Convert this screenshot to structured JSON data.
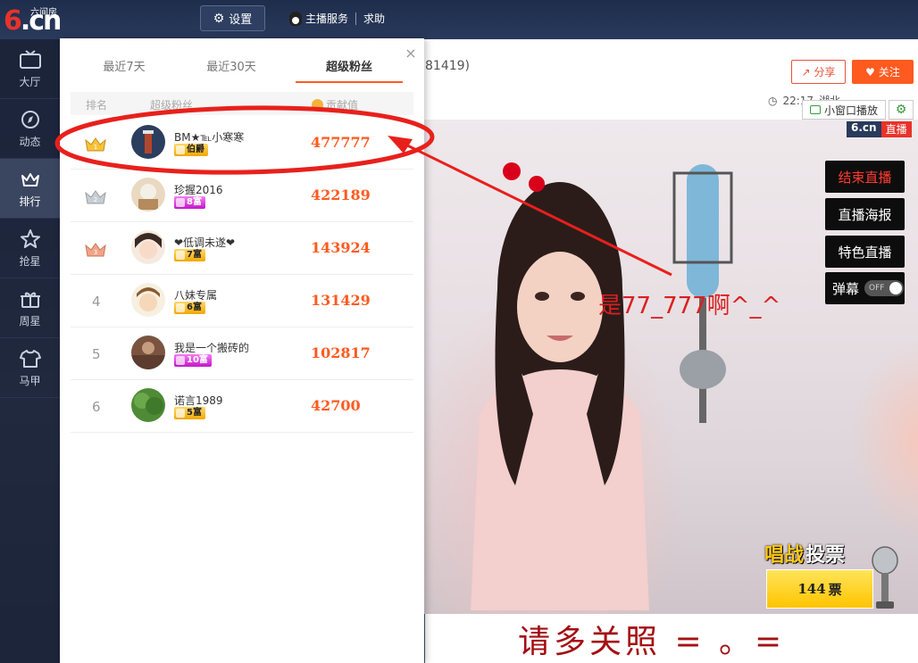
{
  "topbar": {
    "logo_main": "6.cn",
    "logo_sub": "六间房",
    "settings_label": "设置",
    "host_service_label": "主播服务",
    "help_label": "求助"
  },
  "sidebar": {
    "items": [
      {
        "label": "大厅",
        "icon": "tv-icon"
      },
      {
        "label": "动态",
        "icon": "compass-icon"
      },
      {
        "label": "排行",
        "icon": "crown-icon"
      },
      {
        "label": "抢星",
        "icon": "star-icon"
      },
      {
        "label": "周星",
        "icon": "gift-icon"
      },
      {
        "label": "马甲",
        "icon": "shirt-icon"
      }
    ],
    "active_index": 2
  },
  "room": {
    "id_text": "81419)",
    "share_label": "分享",
    "follow_label": "关注",
    "time": "22:17",
    "location_partial": "湖北",
    "mini_window_label": "小窗口播放",
    "video_logo": "6.cn",
    "video_live_tag": "直播"
  },
  "video_actions": {
    "end_live": "结束直播",
    "poster": "直播海报",
    "special": "特色直播",
    "danmu": "弹幕",
    "danmu_toggle": "OFF"
  },
  "video_overlay": {
    "caption": "是77_777啊^_^",
    "vote_title_a": "唱战",
    "vote_title_b": "投票",
    "vote_count": "144",
    "vote_unit": "票",
    "banner": "请多关照 = 。="
  },
  "ranking_popup": {
    "close": "×",
    "tabs": [
      {
        "label": "最近7天"
      },
      {
        "label": "最近30天"
      },
      {
        "label": "超级粉丝"
      }
    ],
    "active_tab": 2,
    "headers": {
      "rank": "排名",
      "fan": "超级粉丝",
      "contribution": "贡献值"
    },
    "rows": [
      {
        "rank": "1",
        "name": "BM★℡小寒寒",
        "badge": "伯爵",
        "badge_style": "gold",
        "contribution": "477777"
      },
      {
        "rank": "2",
        "name": "珍握2016",
        "badge": "8富",
        "badge_style": "purple",
        "contribution": "422189"
      },
      {
        "rank": "3",
        "name": "❤低调未遂❤",
        "badge": "7富",
        "badge_style": "gold",
        "contribution": "143924"
      },
      {
        "rank": "4",
        "name": "八妹专属",
        "badge": "6富",
        "badge_style": "gold",
        "contribution": "131429"
      },
      {
        "rank": "5",
        "name": "我是一个搬砖的",
        "badge": "10富",
        "badge_style": "purple",
        "contribution": "102817"
      },
      {
        "rank": "6",
        "name": "诺言1989",
        "badge": "5富",
        "badge_style": "gold",
        "contribution": "42700"
      }
    ]
  },
  "colors": {
    "accent": "#ff5a1f",
    "annotation_red": "#e8201c",
    "banner_text": "#a40f14"
  }
}
